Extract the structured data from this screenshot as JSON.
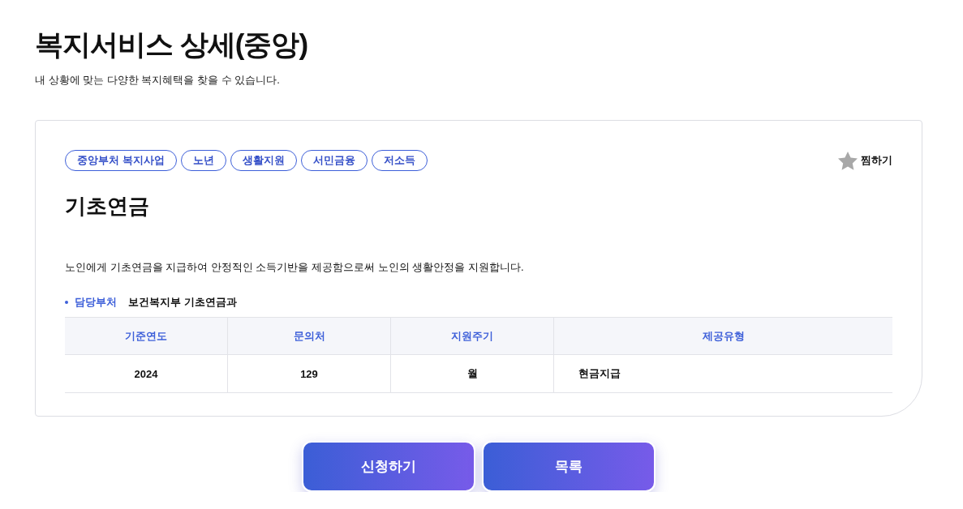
{
  "page": {
    "title": "복지서비스 상세(중앙)",
    "subtitle": "내 상황에 맞는 다양한 복지혜택을 찾을 수 있습니다."
  },
  "service": {
    "tags": [
      "중앙부처 복지사업",
      "노년",
      "생활지원",
      "서민금융",
      "저소득"
    ],
    "favorite": {
      "label": "찜하기",
      "on": false
    },
    "name": "기초연금",
    "description": "노인에게 기초연금을 지급하여 안정적인 소득기반을 제공함으로써 노인의 생활안정을 지원합니다.",
    "department": {
      "label": "담당부처",
      "value": "보건복지부 기초연금과"
    },
    "table": {
      "columns": [
        "기준연도",
        "문의처",
        "지원주기",
        "제공유형"
      ],
      "rows": [
        [
          "2024",
          "129",
          "월",
          "현금지급"
        ]
      ]
    }
  },
  "buttons": [
    "신청하기",
    "목록"
  ]
}
